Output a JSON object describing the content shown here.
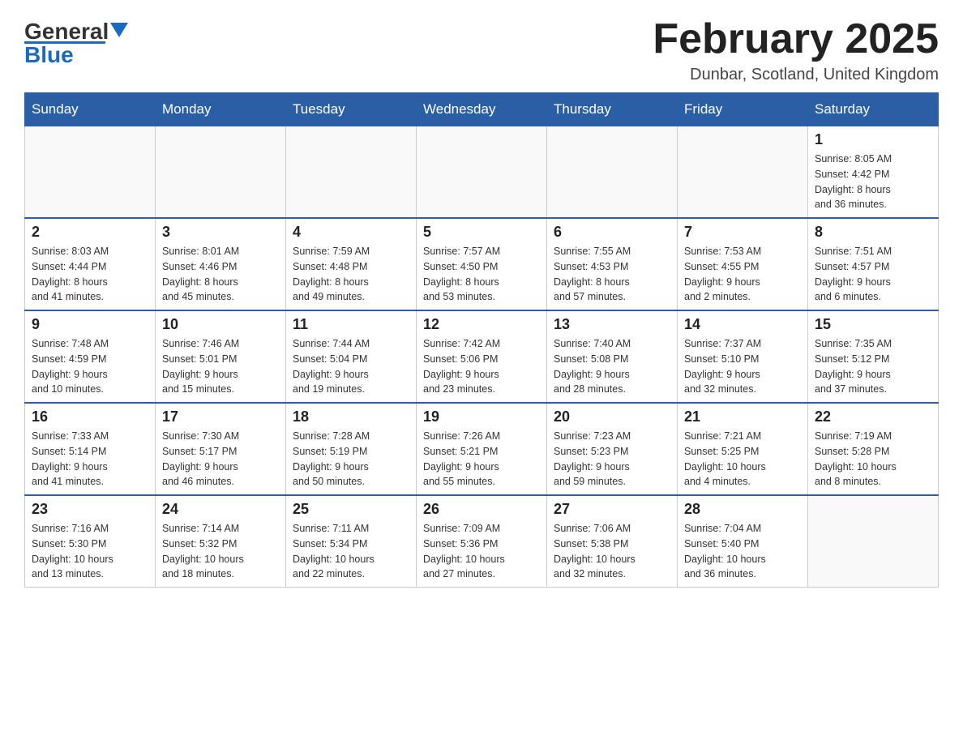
{
  "header": {
    "logo_general": "General",
    "logo_blue": "Blue",
    "month_title": "February 2025",
    "location": "Dunbar, Scotland, United Kingdom"
  },
  "weekdays": [
    "Sunday",
    "Monday",
    "Tuesday",
    "Wednesday",
    "Thursday",
    "Friday",
    "Saturday"
  ],
  "weeks": [
    [
      {
        "day": "",
        "info": ""
      },
      {
        "day": "",
        "info": ""
      },
      {
        "day": "",
        "info": ""
      },
      {
        "day": "",
        "info": ""
      },
      {
        "day": "",
        "info": ""
      },
      {
        "day": "",
        "info": ""
      },
      {
        "day": "1",
        "info": "Sunrise: 8:05 AM\nSunset: 4:42 PM\nDaylight: 8 hours\nand 36 minutes."
      }
    ],
    [
      {
        "day": "2",
        "info": "Sunrise: 8:03 AM\nSunset: 4:44 PM\nDaylight: 8 hours\nand 41 minutes."
      },
      {
        "day": "3",
        "info": "Sunrise: 8:01 AM\nSunset: 4:46 PM\nDaylight: 8 hours\nand 45 minutes."
      },
      {
        "day": "4",
        "info": "Sunrise: 7:59 AM\nSunset: 4:48 PM\nDaylight: 8 hours\nand 49 minutes."
      },
      {
        "day": "5",
        "info": "Sunrise: 7:57 AM\nSunset: 4:50 PM\nDaylight: 8 hours\nand 53 minutes."
      },
      {
        "day": "6",
        "info": "Sunrise: 7:55 AM\nSunset: 4:53 PM\nDaylight: 8 hours\nand 57 minutes."
      },
      {
        "day": "7",
        "info": "Sunrise: 7:53 AM\nSunset: 4:55 PM\nDaylight: 9 hours\nand 2 minutes."
      },
      {
        "day": "8",
        "info": "Sunrise: 7:51 AM\nSunset: 4:57 PM\nDaylight: 9 hours\nand 6 minutes."
      }
    ],
    [
      {
        "day": "9",
        "info": "Sunrise: 7:48 AM\nSunset: 4:59 PM\nDaylight: 9 hours\nand 10 minutes."
      },
      {
        "day": "10",
        "info": "Sunrise: 7:46 AM\nSunset: 5:01 PM\nDaylight: 9 hours\nand 15 minutes."
      },
      {
        "day": "11",
        "info": "Sunrise: 7:44 AM\nSunset: 5:04 PM\nDaylight: 9 hours\nand 19 minutes."
      },
      {
        "day": "12",
        "info": "Sunrise: 7:42 AM\nSunset: 5:06 PM\nDaylight: 9 hours\nand 23 minutes."
      },
      {
        "day": "13",
        "info": "Sunrise: 7:40 AM\nSunset: 5:08 PM\nDaylight: 9 hours\nand 28 minutes."
      },
      {
        "day": "14",
        "info": "Sunrise: 7:37 AM\nSunset: 5:10 PM\nDaylight: 9 hours\nand 32 minutes."
      },
      {
        "day": "15",
        "info": "Sunrise: 7:35 AM\nSunset: 5:12 PM\nDaylight: 9 hours\nand 37 minutes."
      }
    ],
    [
      {
        "day": "16",
        "info": "Sunrise: 7:33 AM\nSunset: 5:14 PM\nDaylight: 9 hours\nand 41 minutes."
      },
      {
        "day": "17",
        "info": "Sunrise: 7:30 AM\nSunset: 5:17 PM\nDaylight: 9 hours\nand 46 minutes."
      },
      {
        "day": "18",
        "info": "Sunrise: 7:28 AM\nSunset: 5:19 PM\nDaylight: 9 hours\nand 50 minutes."
      },
      {
        "day": "19",
        "info": "Sunrise: 7:26 AM\nSunset: 5:21 PM\nDaylight: 9 hours\nand 55 minutes."
      },
      {
        "day": "20",
        "info": "Sunrise: 7:23 AM\nSunset: 5:23 PM\nDaylight: 9 hours\nand 59 minutes."
      },
      {
        "day": "21",
        "info": "Sunrise: 7:21 AM\nSunset: 5:25 PM\nDaylight: 10 hours\nand 4 minutes."
      },
      {
        "day": "22",
        "info": "Sunrise: 7:19 AM\nSunset: 5:28 PM\nDaylight: 10 hours\nand 8 minutes."
      }
    ],
    [
      {
        "day": "23",
        "info": "Sunrise: 7:16 AM\nSunset: 5:30 PM\nDaylight: 10 hours\nand 13 minutes."
      },
      {
        "day": "24",
        "info": "Sunrise: 7:14 AM\nSunset: 5:32 PM\nDaylight: 10 hours\nand 18 minutes."
      },
      {
        "day": "25",
        "info": "Sunrise: 7:11 AM\nSunset: 5:34 PM\nDaylight: 10 hours\nand 22 minutes."
      },
      {
        "day": "26",
        "info": "Sunrise: 7:09 AM\nSunset: 5:36 PM\nDaylight: 10 hours\nand 27 minutes."
      },
      {
        "day": "27",
        "info": "Sunrise: 7:06 AM\nSunset: 5:38 PM\nDaylight: 10 hours\nand 32 minutes."
      },
      {
        "day": "28",
        "info": "Sunrise: 7:04 AM\nSunset: 5:40 PM\nDaylight: 10 hours\nand 36 minutes."
      },
      {
        "day": "",
        "info": ""
      }
    ]
  ]
}
